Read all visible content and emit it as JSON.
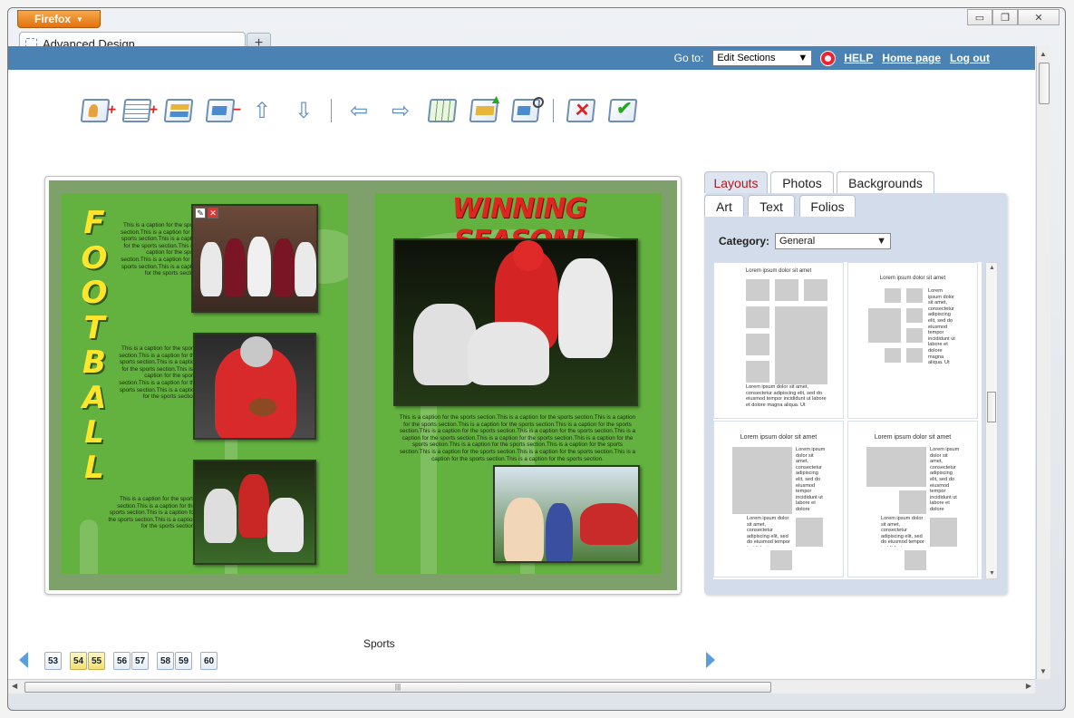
{
  "browser": {
    "app_button": "Firefox",
    "tab_title": "Advanced Design",
    "new_tab": "+",
    "controls": {
      "minimize": "▭",
      "restore": "❐",
      "close": "✕"
    }
  },
  "topbar": {
    "goto_label": "Go to:",
    "goto_value": "Edit Sections",
    "help": "HELP",
    "home": "Home page",
    "logout": "Log out"
  },
  "toolbar_icons": [
    "add-person-page-icon",
    "add-text-page-icon",
    "edit-page-icon",
    "remove-page-icon",
    "move-up-icon",
    "move-down-icon",
    "undo-icon",
    "redo-icon",
    "grid-icon",
    "upload-page-icon",
    "preview-page-icon",
    "cancel-icon",
    "approve-icon"
  ],
  "spread": {
    "left_title": [
      "F",
      "O",
      "O",
      "T",
      "B",
      "A",
      "L",
      "L"
    ],
    "right_title": "WINNING SEASON!",
    "caption_short": "This is a caption for the sports section.This is a caption for the sports section.This is a caption for the sports section.This is a caption for the sports section.This is a caption for the sports section.This is a caption for the sports section.",
    "caption_mid": "This is a caption for the sports section.This is a caption for the sports section.This is a caption for the sports section.This is a caption for the sports section.This is a caption for the sports section.This is a caption for the sports section.",
    "caption_low": "This is a caption for the sports section.This is a caption for the sports section.This is a caption for the sports section.This is a caption for the sports section.",
    "caption_wide": "This is a caption for the sports section.This is a caption for the sports section.This is a caption for the sports section.This is a caption for the sports section.This is a caption for the sports section.This is a caption for the sports section.This is a caption for the sports section.This is a caption for the sports section.This is a caption for the sports section.This is a caption for the sports section.This is a caption for the sports section.This is a caption for the sports section.This is a caption for the sports section.This is a caption for the sports section.This is a caption for the sports section.This is a caption for the sports section."
  },
  "panel": {
    "tabs_row1": [
      "Layouts",
      "Photos",
      "Backgrounds"
    ],
    "tabs_row2": [
      "Art",
      "Text",
      "Folios"
    ],
    "category_label": "Category:",
    "category_value": "General",
    "layout_title": "Lorem ipsum dolor sit amet",
    "lorem_narrow": "Lorem ipsum dolor sit amet, consectetur adipiscing elit, sed do eiusmod tempor incididunt ut labore et dolore magna aliqua. Ut enim ad",
    "lorem_wide": "Lorem ipsum dolor sit amet, consectetur adipiscing elit, sed do eiusmod tempor incididunt ut labore et dolore magna aliqua. Ut",
    "lorem_small": "Lorem ipsum dolor sit amet, consectetur adipiscing elit, sed do eiusmod tempor incididunt"
  },
  "footer": {
    "section_label": "Sports",
    "pages": [
      "53",
      "54",
      "55",
      "56",
      "57",
      "58",
      "59",
      "60"
    ]
  },
  "colors": {
    "accent_blue": "#4a82b4",
    "page_green": "#63b13f",
    "title_red": "#e0241f",
    "title_yellow": "#ffe62b"
  }
}
